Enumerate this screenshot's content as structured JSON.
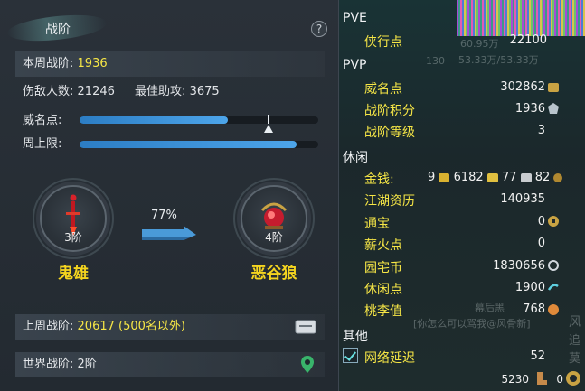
{
  "left": {
    "title": "战阶",
    "help": "?",
    "weekly_label": "本周战阶:",
    "weekly_value": "1936",
    "kill_label": "伤敌人数:",
    "kill_value": "21246",
    "assist_label": "最佳助攻:",
    "assist_value": "3675",
    "fame_label": "威名点:",
    "fame_fill": 0.62,
    "fame_marker": 0.79,
    "cap_label": "周上限:",
    "cap_fill": 0.91,
    "current_rank": {
      "level": "3阶",
      "name": "鬼雄"
    },
    "next_rank": {
      "level": "4阶",
      "name": "恶谷狼"
    },
    "progress_pct": "77%",
    "last_week_label": "上周战阶:",
    "last_week_value": "20617 (500名以外)",
    "world_label": "世界战阶:",
    "world_value": "2阶"
  },
  "right": {
    "pve": "PVE",
    "xiaxing_label": "侠行点",
    "xiaxing_value": "22100",
    "pvp": "PVP",
    "weiming_label": "威名点",
    "weiming_value": "302862",
    "zhanjie_score_label": "战阶积分",
    "zhanjie_score_value": "1936",
    "zhanjie_level_label": "战阶等级",
    "zhanjie_level_value": "3",
    "leisure": "休闲",
    "money_label": "金钱:",
    "money_a": "9",
    "money_b": "6182",
    "money_c": "77",
    "money_d": "82",
    "jianghu_label": "江湖资历",
    "jianghu_value": "140935",
    "tongbao_label": "通宝",
    "tongbao_value": "0",
    "xinhuo_label": "薪火点",
    "xinhuo_value": "0",
    "yuanzhai_label": "园宅币",
    "yuanzhai_value": "1830656",
    "xiuxian_label": "休闲点",
    "xiuxian_value": "1900",
    "taoli_label": "桃李值",
    "taoli_value": "768",
    "other": "其他",
    "latency_label": "网络延迟",
    "latency_value": "52",
    "bottom_value": "5230",
    "bottom_zero": "0",
    "ghost_1": "60.95万",
    "ghost_2": "53.33万/53.33万",
    "ghost_3": "130",
    "ghost_4": "幕后黑",
    "ghost_5": "[你怎么可以骂我@风骨新]",
    "ghost_6": "风",
    "ghost_7": "追",
    "ghost_8": "莫"
  },
  "colors": {
    "accent_yellow": "#f6e646",
    "bar_blue": "#3a8fd8",
    "rank_gold": "#f5d51f"
  }
}
